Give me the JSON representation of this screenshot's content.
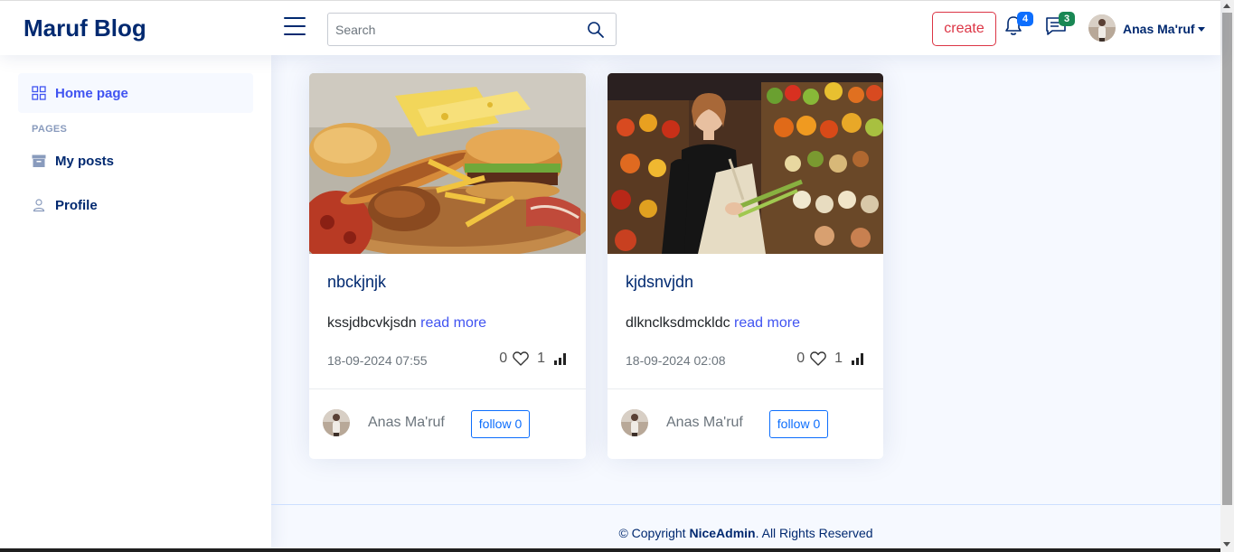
{
  "header": {
    "logo": "Maruf Blog",
    "search_placeholder": "Search",
    "create_label": "create",
    "notifications_count": "4",
    "messages_count": "3",
    "user_name": "Anas Ma'ruf"
  },
  "sidebar": {
    "home_label": "Home page",
    "pages_heading": "PAGES",
    "my_posts_label": "My posts",
    "profile_label": "Profile"
  },
  "posts": [
    {
      "title": "nbckjnjk",
      "excerpt": "kssjdbcvkjsdn",
      "read_more": "read more",
      "date": "18-09-2024 07:55",
      "likes": "0",
      "views": "1",
      "author": "Anas Ma'ruf",
      "follow_label": "follow 0"
    },
    {
      "title": "kjdsnvjdn",
      "excerpt": "dlknclksdmckldc",
      "read_more": "read more",
      "date": "18-09-2024 02:08",
      "likes": "0",
      "views": "1",
      "author": "Anas Ma'ruf",
      "follow_label": "follow 0"
    }
  ],
  "footer": {
    "prefix": "© Copyright",
    "brand": "NiceAdmin",
    "suffix": ". All Rights Reserved"
  },
  "colors": {
    "brand": "#012970",
    "accent": "#4154f1",
    "danger": "#dc3545",
    "notif_badge": "#0d6efd",
    "msg_badge": "#198754"
  }
}
